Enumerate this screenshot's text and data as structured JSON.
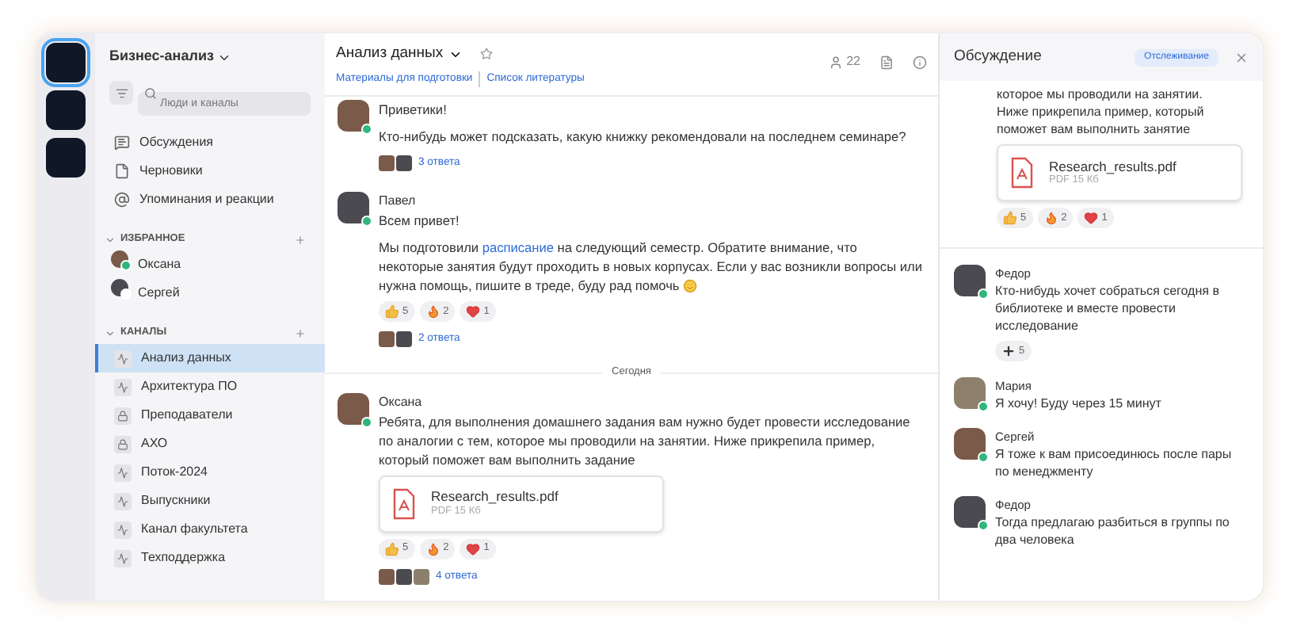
{
  "workspaces": [
    {
      "selected": true
    },
    {
      "selected": false
    },
    {
      "selected": false
    }
  ],
  "sidebar": {
    "title": "Бизнес-анализ",
    "search": {
      "placeholder": "Люди и каналы"
    },
    "nav": [
      {
        "kind": "discussions",
        "label": "Обсуждения"
      },
      {
        "kind": "drafts",
        "label": "Черновики"
      },
      {
        "kind": "mentions",
        "label": "Упоминания и реакции"
      }
    ],
    "favorites": {
      "title": "ИЗБРАННОЕ",
      "expanded": true,
      "items": [
        {
          "name": "Оксана",
          "online": true
        },
        {
          "name": "Сергей",
          "online": false
        }
      ]
    },
    "channels": {
      "title": "КАНАЛЫ",
      "expanded": true,
      "items": [
        {
          "label": "Анализ данных",
          "kind": "public",
          "selected": true
        },
        {
          "label": "Архитектура ПО",
          "kind": "public",
          "selected": false
        },
        {
          "label": "Преподаватели",
          "kind": "private",
          "selected": false
        },
        {
          "label": "АХО",
          "kind": "private",
          "selected": false
        },
        {
          "label": "Поток-2024",
          "kind": "public",
          "selected": false
        },
        {
          "label": "Выпускники",
          "kind": "public",
          "selected": false
        },
        {
          "label": "Канал факультета",
          "kind": "public",
          "selected": false
        },
        {
          "label": "Техподдержка",
          "kind": "public",
          "selected": false
        }
      ]
    }
  },
  "channel": {
    "title": "Анализ данных",
    "links": [
      "Материалы для подготовки",
      "Список литературы"
    ],
    "members": "22"
  },
  "messages": [
    {
      "online": true,
      "lines": [
        "Приветики!",
        "Кто-нибудь может подсказать, какую книжку рекомендовали на последнем семинаре?"
      ],
      "replies": {
        "count": "3 ответа",
        "participants": [
          {
            "kind": "photo"
          },
          {
            "kind": "photo"
          }
        ]
      }
    },
    {
      "author": "Павел",
      "online": true,
      "lines": [
        "Всем привет!"
      ],
      "paragraph": {
        "before": "Мы подготовили ",
        "link": "расписание",
        "after": " на следующий семестр. Обратите внимание, что некоторые занятия будут проходить в новых корпусах. Если у вас возникли вопросы или нужна помощь, пишите в треде, буду рад помочь"
      },
      "reactions": [
        {
          "kind": "thumbs",
          "count": "5"
        },
        {
          "kind": "fire",
          "count": "2"
        },
        {
          "kind": "heart",
          "count": "1"
        }
      ],
      "replies": {
        "count": "2 ответа",
        "participants": [
          {
            "kind": "photo"
          },
          {
            "kind": "photo"
          }
        ]
      }
    },
    {
      "divider": "Сегодня"
    },
    {
      "author": "Оксана",
      "online": true,
      "lines": [
        "Ребята, для выполнения домашнего задания вам нужно будет провести исследование по аналогии с тем, которое мы проводили на занятии. Ниже прикрепила пример, который поможет вам выполнить задание"
      ],
      "file": {
        "name": "Research_results.pdf",
        "meta": "PDF 15 Кб"
      },
      "reactions": [
        {
          "kind": "thumbs",
          "count": "5"
        },
        {
          "kind": "fire",
          "count": "2"
        },
        {
          "kind": "heart",
          "count": "1"
        }
      ],
      "replies": {
        "count": "4 ответа",
        "participants": [
          {
            "kind": "photo"
          },
          {
            "kind": "photo"
          },
          {
            "kind": "photo"
          }
        ]
      }
    }
  ],
  "thread": {
    "title": "Обсуждение",
    "follow_button": "Отслеживание",
    "root": {
      "text": "которое мы проводили на занятии. Ниже прикрепила пример, который поможет вам выполнить занятие",
      "file": {
        "name": "Research_results.pdf",
        "meta": "PDF 15 Кб"
      },
      "reactions": [
        {
          "kind": "thumbs",
          "count": "5"
        },
        {
          "kind": "fire",
          "count": "2"
        },
        {
          "kind": "heart",
          "count": "1"
        }
      ]
    },
    "replies": [
      {
        "author": "Федор",
        "online": true,
        "text": "Кто-нибудь хочет собраться сегодня в библиотеке и вместе провести исследование",
        "reactions": [
          {
            "kind": "plus",
            "count": "5"
          }
        ]
      },
      {
        "author": "Мария",
        "online": true,
        "text": "Я хочу! Буду через 15 минут"
      },
      {
        "author": "Сергей",
        "online": true,
        "text": "Я тоже к вам присоединюсь после пары по менеджменту"
      },
      {
        "author": "Федор",
        "online": true,
        "text": "Тогда предлагаю разбиться в группы по два человека"
      }
    ]
  }
}
